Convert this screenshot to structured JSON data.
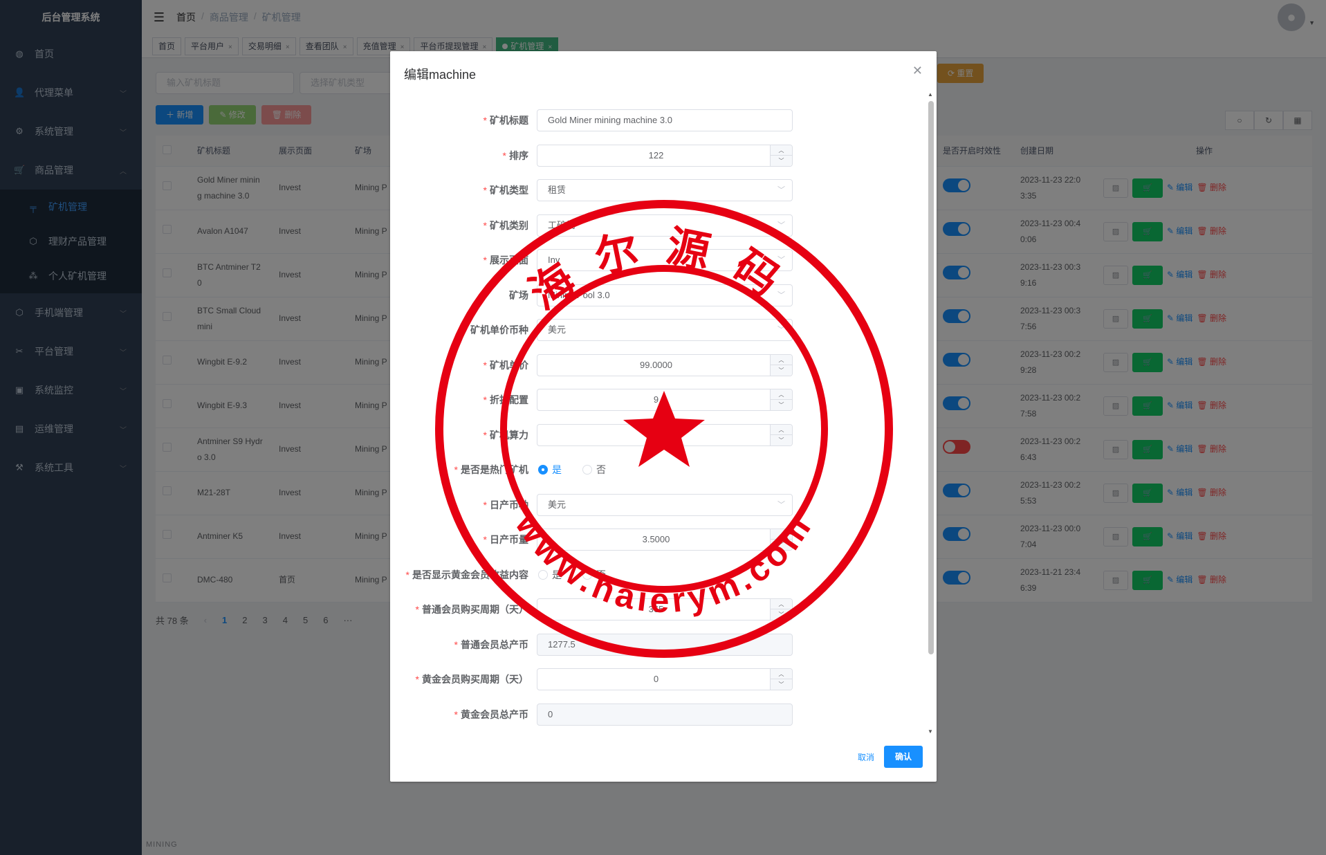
{
  "app": {
    "title": "后台管理系统"
  },
  "sidebar": {
    "items": [
      {
        "label": "首页",
        "icon": "dashboard-icon"
      },
      {
        "label": "代理菜单",
        "icon": "user-icon"
      },
      {
        "label": "系统管理",
        "icon": "gear-icon"
      },
      {
        "label": "商品管理",
        "icon": "cart-icon"
      },
      {
        "label": "手机端管理",
        "icon": "cube-icon"
      },
      {
        "label": "平台管理",
        "icon": "tools-icon"
      },
      {
        "label": "系统监控",
        "icon": "monitor-icon"
      },
      {
        "label": "运维管理",
        "icon": "server-icon"
      },
      {
        "label": "系统工具",
        "icon": "wrench-icon"
      }
    ],
    "submenu": [
      {
        "label": "矿机管理",
        "icon": "machine-icon"
      },
      {
        "label": "理财产品管理",
        "icon": "box-icon"
      },
      {
        "label": "个人矿机管理",
        "icon": "tree-icon"
      }
    ]
  },
  "breadcrumb": [
    "首页",
    "商品管理",
    "矿机管理"
  ],
  "tags": [
    "首页",
    "平台用户",
    "交易明细",
    "查看团队",
    "充值管理",
    "平台币提现管理",
    "矿机管理"
  ],
  "filter": {
    "title_placeholder": "输入矿机标题",
    "type_placeholder": "选择矿机类型",
    "reset_label": "重置"
  },
  "toolbar": {
    "add": "新增",
    "edit": "修改",
    "delete": "删除"
  },
  "table": {
    "headers": [
      "矿机标题",
      "展示页面",
      "矿场",
      "是否开启时效性",
      "创建日期",
      "操作"
    ],
    "rows": [
      {
        "title": "Gold Miner minin g machine 3.0",
        "page": "Invest",
        "field": "Mining P",
        "on": true,
        "date": "2023-11-23 22:0 3:35"
      },
      {
        "title": "Avalon A1047",
        "page": "Invest",
        "field": "Mining P",
        "on": true,
        "date": "2023-11-23 00:4 0:06"
      },
      {
        "title": "BTC Antminer T2 0",
        "page": "Invest",
        "field": "Mining P",
        "on": true,
        "date": "2023-11-23 00:3 9:16"
      },
      {
        "title": "BTC Small Cloud mini",
        "page": "Invest",
        "field": "Mining P",
        "on": true,
        "date": "2023-11-23 00:3 7:56"
      },
      {
        "title": "Wingbit E-9.2",
        "page": "Invest",
        "field": "Mining P",
        "on": true,
        "date": "2023-11-23 00:2 9:28"
      },
      {
        "title": "Wingbit E-9.3",
        "page": "Invest",
        "field": "Mining P",
        "on": true,
        "date": "2023-11-23 00:2 7:58"
      },
      {
        "title": "Antminer S9 Hydr o 3.0",
        "page": "Invest",
        "field": "Mining P",
        "on": false,
        "date": "2023-11-23 00:2 6:43"
      },
      {
        "title": "M21-28T",
        "page": "Invest",
        "field": "Mining P",
        "on": true,
        "date": "2023-11-23 00:2 5:53"
      },
      {
        "title": "Antminer K5",
        "page": "Invest",
        "field": "Mining P",
        "on": true,
        "date": "2023-11-23 00:0 7:04"
      },
      {
        "title": "DMC-480",
        "page": "首页",
        "field": "Mining P",
        "on": true,
        "date": "2023-11-21 23:4 6:39"
      }
    ],
    "row_edit": "编辑",
    "row_delete": "删除"
  },
  "pager": {
    "total": "共 78 条",
    "pages": [
      "1",
      "2",
      "3",
      "4",
      "5",
      "6",
      "···"
    ]
  },
  "footer": "MINING",
  "dialog": {
    "title": "编辑machine",
    "fields": [
      {
        "label": "矿机标题",
        "req": true,
        "kind": "text",
        "value": "Gold Miner mining machine 3.0"
      },
      {
        "label": "排序",
        "req": true,
        "kind": "number",
        "value": "122"
      },
      {
        "label": "矿机类型",
        "req": true,
        "kind": "select",
        "value": "租赁"
      },
      {
        "label": "矿机类别",
        "req": true,
        "kind": "select",
        "value": "工矿机"
      },
      {
        "label": "展示页面",
        "req": true,
        "kind": "select",
        "value": "Inv"
      },
      {
        "label": "矿场",
        "req": false,
        "kind": "select",
        "value": "Mining Pool 3.0"
      },
      {
        "label": "矿机单价币种",
        "req": true,
        "kind": "select",
        "value": "美元"
      },
      {
        "label": "矿机单价",
        "req": true,
        "kind": "number",
        "value": "99.0000"
      },
      {
        "label": "折扣配置",
        "req": true,
        "kind": "number",
        "value": "9"
      },
      {
        "label": "矿机算力",
        "req": true,
        "kind": "number",
        "value": ""
      },
      {
        "label": "是否是热门矿机",
        "req": true,
        "kind": "radio",
        "value": "是",
        "options": [
          "是",
          "否"
        ]
      },
      {
        "label": "日产币种",
        "req": true,
        "kind": "select",
        "value": "美元"
      },
      {
        "label": "日产币量",
        "req": true,
        "kind": "number",
        "value": "3.5000"
      },
      {
        "label": "是否显示黄金会员收益内容",
        "req": true,
        "kind": "radio",
        "value": "",
        "options": [
          "是",
          "否"
        ]
      },
      {
        "label": "普通会员购买周期（天）",
        "req": true,
        "kind": "number",
        "value": "365"
      },
      {
        "label": "普通会员总产币",
        "req": true,
        "kind": "disabled",
        "value": "1277.5"
      },
      {
        "label": "黄金会员购买周期（天）",
        "req": true,
        "kind": "number",
        "value": "0"
      },
      {
        "label": "黄金会员总产币",
        "req": true,
        "kind": "disabled",
        "value": "0"
      }
    ],
    "cancel": "取消",
    "ok": "确认"
  },
  "seal": {
    "top_text": "海尔源码",
    "bottom_text": "www.haierym.com",
    "color": "#e60012"
  },
  "colors": {
    "primary": "#1890ff",
    "sidebar": "#304156",
    "success": "#13ce66",
    "danger": "#ff4949"
  }
}
